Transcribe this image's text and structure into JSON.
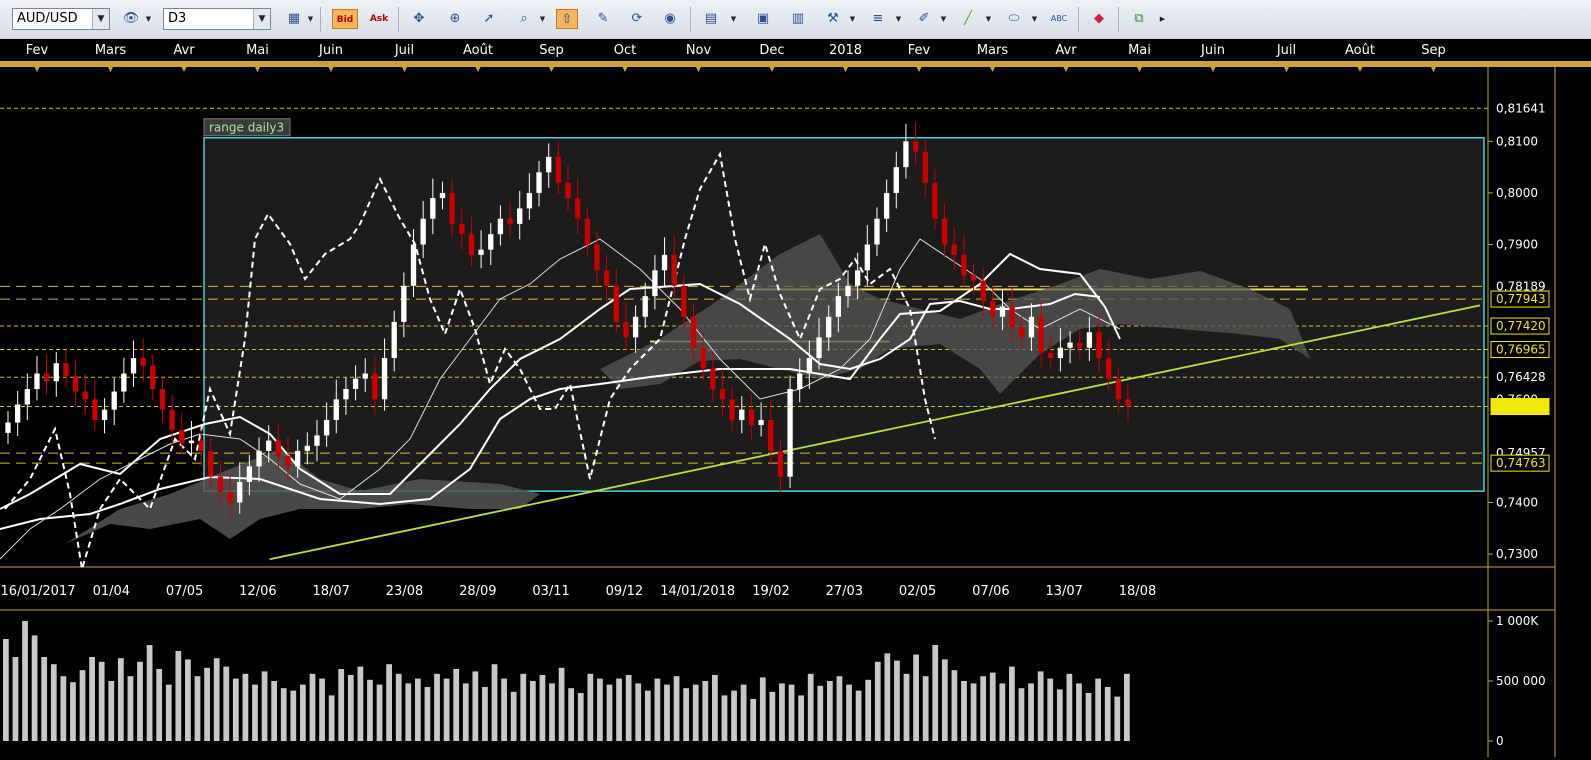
{
  "toolbar": {
    "symbol": "AUD/USD",
    "timeframe": "D3",
    "bid_label": "Bid",
    "ask_label": "Ask",
    "icons": [
      "eye-icon",
      "chart-type-icon",
      "crosshair-icon",
      "zoom-in-icon",
      "zoom-out-icon",
      "cursor-icon",
      "magnifier-icon",
      "trendline-active-icon",
      "note-icon",
      "refresh-icon",
      "globe-icon",
      "ruler-icon",
      "image-icon",
      "calc-icon",
      "tools-icon",
      "lines-icon",
      "draw-icon",
      "pen-icon",
      "ellipse-icon",
      "text-abc-icon",
      "eraser-icon",
      "network-icon",
      "more-icon"
    ]
  },
  "colors": {
    "background": "#000000",
    "panel": "#1a1a1a",
    "bull": "#ffffff",
    "bear": "#cc0000",
    "range_box": "#4fd1d9",
    "trendline": "#b9e23b",
    "level": "#e0d640",
    "cloud": "#555555",
    "price_tag": "#f2e90a"
  },
  "time_axis": {
    "months": [
      "Fev",
      "Mars",
      "Avr",
      "Mai",
      "Juin",
      "Juil",
      "Août",
      "Sep",
      "Oct",
      "Nov",
      "Dec",
      "2018",
      "Fev",
      "Mars",
      "Avr",
      "Mai",
      "Juin",
      "Juil",
      "Août",
      "Sep"
    ],
    "dates": [
      "16/01/2017",
      "01/04",
      "07/05",
      "12/06",
      "18/07",
      "23/08",
      "28/09",
      "03/11",
      "09/12",
      "14/01/2018",
      "19/02",
      "27/03",
      "02/05",
      "07/06",
      "13/07",
      "18/08"
    ]
  },
  "price_axis": {
    "ticks": [
      "0,8100",
      "0,8000",
      "0,7900",
      "0,7400",
      "0,7300"
    ],
    "tags": [
      "0,81641",
      "0,78189",
      "0,77943",
      "0,77420",
      "0,76965",
      "0,76428",
      "0,7586",
      "0,74957",
      "0,74763"
    ],
    "highlighted_tags": [
      "0,77943",
      "0,77420",
      "0,76965",
      "0,7586",
      "0,74763"
    ],
    "partial_labels": [
      "0,7600",
      "0,7700"
    ]
  },
  "range_box": {
    "label": "range daily3"
  },
  "volume_axis": {
    "ticks": [
      "1 000K",
      "500 000",
      "0"
    ]
  },
  "chart_data": [
    {
      "type": "candlestick",
      "symbol": "AUD/USD",
      "timeframe": "D3",
      "title": "",
      "x_range": [
        "2017-01-16",
        "2018-09-30"
      ],
      "y_range": [
        0.7275,
        0.8215
      ],
      "levels": [
        0.81641,
        0.8107,
        0.78189,
        0.77943,
        0.7742,
        0.76965,
        0.76428,
        0.7586,
        0.74957,
        0.74763
      ],
      "range_box": {
        "label": "range daily3",
        "start": "2017-04-01",
        "end": "2018-09-30",
        "high": 0.8107,
        "low": 0.7422
      },
      "trendline": {
        "start": [
          "2017-05-07",
          0.729
        ],
        "end": [
          "2018-09-30",
          0.7782
        ]
      },
      "close_series": [
        0.7555,
        0.759,
        0.762,
        0.765,
        0.7635,
        0.767,
        0.7645,
        0.7615,
        0.76,
        0.756,
        0.758,
        0.7615,
        0.765,
        0.768,
        0.7665,
        0.762,
        0.758,
        0.754,
        0.7515,
        0.752,
        0.75,
        0.745,
        0.742,
        0.74,
        0.744,
        0.747,
        0.75,
        0.752,
        0.749,
        0.747,
        0.75,
        0.751,
        0.753,
        0.756,
        0.76,
        0.762,
        0.764,
        0.765,
        0.76,
        0.768,
        0.775,
        0.782,
        0.79,
        0.795,
        0.799,
        0.8,
        0.794,
        0.792,
        0.788,
        0.789,
        0.792,
        0.795,
        0.794,
        0.797,
        0.8,
        0.804,
        0.807,
        0.802,
        0.799,
        0.795,
        0.79,
        0.785,
        0.782,
        0.775,
        0.772,
        0.776,
        0.78,
        0.785,
        0.788,
        0.782,
        0.776,
        0.77,
        0.766,
        0.762,
        0.76,
        0.756,
        0.758,
        0.755,
        0.756,
        0.75,
        0.745,
        0.762,
        0.765,
        0.768,
        0.772,
        0.776,
        0.78,
        0.782,
        0.785,
        0.79,
        0.795,
        0.8,
        0.805,
        0.81,
        0.808,
        0.802,
        0.795,
        0.79,
        0.788,
        0.784,
        0.783,
        0.779,
        0.776,
        0.778,
        0.774,
        0.772,
        0.776,
        0.769,
        0.768,
        0.77,
        0.771,
        0.77,
        0.773,
        0.768,
        0.764,
        0.76,
        0.7586
      ],
      "volume_series": [
        850,
        700,
        1000,
        880,
        700,
        640,
        540,
        490,
        590,
        700,
        660,
        500,
        690,
        540,
        660,
        800,
        600,
        470,
        750,
        680,
        540,
        610,
        690,
        620,
        520,
        560,
        470,
        580,
        500,
        440,
        420,
        470,
        560,
        520,
        380,
        600,
        550,
        620,
        510,
        470,
        640,
        560,
        480,
        520,
        450,
        560,
        520,
        600,
        480,
        580,
        450,
        640,
        520,
        410,
        560,
        500,
        550,
        480,
        610,
        440,
        400,
        560,
        520,
        470,
        520,
        550,
        480,
        420,
        520,
        470,
        540,
        440,
        470,
        500,
        550,
        380,
        420,
        470,
        350,
        530,
        410,
        480,
        470,
        380,
        560,
        460,
        500,
        540,
        470,
        420,
        510,
        660,
        730,
        670,
        560,
        720,
        540,
        800,
        680,
        590,
        500,
        480,
        540,
        570,
        480,
        620,
        440,
        480,
        580,
        520,
        430,
        560,
        480,
        400,
        520,
        450,
        370,
        560
      ]
    }
  ]
}
